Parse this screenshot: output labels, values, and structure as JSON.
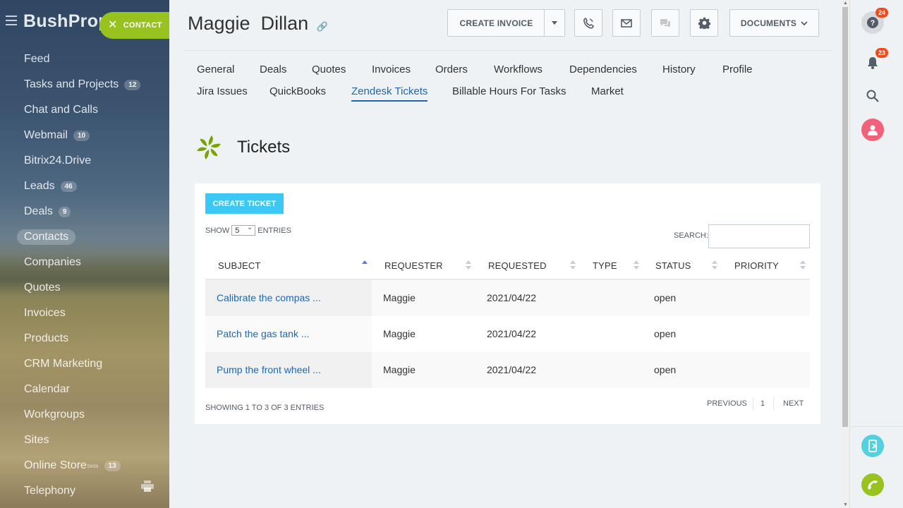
{
  "brand": "BushProp",
  "contact_button": "CONTACT",
  "sidebar": {
    "items": [
      {
        "label": "Feed",
        "count": ""
      },
      {
        "label": "Tasks and Projects",
        "count": "12"
      },
      {
        "label": "Chat and Calls",
        "count": ""
      },
      {
        "label": "Webmail",
        "count": "10"
      },
      {
        "label": "Bitrix24.Drive",
        "count": ""
      },
      {
        "label": "Leads",
        "count": "46"
      },
      {
        "label": "Deals",
        "count": "9"
      },
      {
        "label": "Contacts",
        "count": ""
      },
      {
        "label": "Companies",
        "count": ""
      },
      {
        "label": "Quotes",
        "count": ""
      },
      {
        "label": "Invoices",
        "count": ""
      },
      {
        "label": "Products",
        "count": ""
      },
      {
        "label": "CRM Marketing",
        "count": ""
      },
      {
        "label": "Calendar",
        "count": ""
      },
      {
        "label": "Workgroups",
        "count": ""
      },
      {
        "label": "Sites",
        "count": ""
      },
      {
        "label": "Online Store",
        "count": "13",
        "sup": "beta"
      },
      {
        "label": "Telephony",
        "count": ""
      }
    ],
    "active_index": 7
  },
  "header": {
    "first_name": "Maggie",
    "last_name": "Dillan",
    "create_invoice": "CREATE INVOICE",
    "documents": "DOCUMENTS"
  },
  "tabs": [
    "General",
    "Deals",
    "Quotes",
    "Invoices",
    "Orders",
    "Workflows",
    "Dependencies",
    "History",
    "Profile",
    "Jira Issues",
    "QuickBooks",
    "Zendesk Tickets",
    "Billable Hours For Tasks",
    "Market"
  ],
  "active_tab": "Zendesk Tickets",
  "section_title": "Tickets",
  "tickets": {
    "create_button": "CREATE TICKET",
    "show_label": "SHOW",
    "entries_value": "5",
    "entries_label": "ENTRIES",
    "search_label": "SEARCH:",
    "search_value": "",
    "columns": [
      "SUBJECT",
      "REQUESTER",
      "REQUESTED",
      "TYPE",
      "STATUS",
      "PRIORITY"
    ],
    "sorted_column": "SUBJECT",
    "rows": [
      {
        "subject": "Calibrate the compas ...",
        "requester": "Maggie",
        "requested": "2021/04/22",
        "type": "",
        "status": "open",
        "priority": ""
      },
      {
        "subject": "Patch the gas tank ...",
        "requester": "Maggie",
        "requested": "2021/04/22",
        "type": "",
        "status": "open",
        "priority": ""
      },
      {
        "subject": "Pump the front wheel ...",
        "requester": "Maggie",
        "requested": "2021/04/22",
        "type": "",
        "status": "open",
        "priority": ""
      }
    ],
    "info": "SHOWING 1 TO 3 OF 3 ENTRIES",
    "pager": {
      "previous": "PREVIOUS",
      "page": "1",
      "next": "NEXT"
    }
  },
  "rightbar": {
    "help_badge": "24",
    "notifications_badge": "23"
  },
  "colors": {
    "accent_blue": "#2067b0",
    "contact_green": "#98c21d",
    "create_ticket_cyan": "#3bc8f5",
    "badge_red": "#f54819",
    "zendesk_green": "#78a300"
  }
}
